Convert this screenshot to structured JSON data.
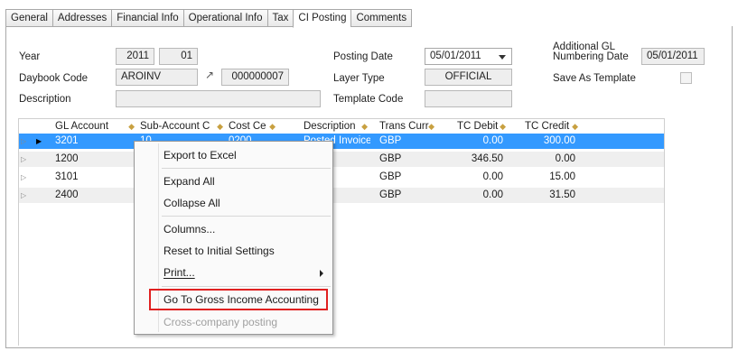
{
  "tabs": [
    {
      "label": "General"
    },
    {
      "label": "Addresses"
    },
    {
      "label": "Financial Info"
    },
    {
      "label": "Operational Info"
    },
    {
      "label": "Tax"
    },
    {
      "label": "CI Posting",
      "active": true
    },
    {
      "label": "Comments"
    }
  ],
  "form": {
    "year_label": "Year",
    "year_value": "2011",
    "period_value": "01",
    "daybook_label": "Daybook Code",
    "daybook_value": "AROINV",
    "daybook_number": "000000007",
    "description_label": "Description",
    "description_value": "",
    "posting_date_label": "Posting Date",
    "posting_date_value": "05/01/2011",
    "layer_type_label": "Layer Type",
    "layer_type_value": "OFFICIAL",
    "template_code_label": "Template Code",
    "template_code_value": "",
    "additional_gl_label_1": "Additional GL",
    "additional_gl_label_2": "Numbering Date",
    "additional_gl_value": "05/01/2011",
    "save_as_template_label": "Save As Template"
  },
  "grid": {
    "columns": [
      "GL Account",
      "Sub-Account C",
      "Cost Ce",
      "Description",
      "Trans Curr",
      "TC Debit",
      "TC Credit"
    ],
    "rows": [
      {
        "gl": "3201",
        "sub": "10",
        "cost": "0200",
        "desc": "Posted Invoice",
        "curr": "GBP",
        "debit": "0.00",
        "credit": "300.00"
      },
      {
        "gl": "1200",
        "sub": "",
        "cost": "",
        "desc": "ce",
        "curr": "GBP",
        "debit": "346.50",
        "credit": "0.00"
      },
      {
        "gl": "3101",
        "sub": "",
        "cost": "",
        "desc": "ce",
        "curr": "GBP",
        "debit": "0.00",
        "credit": "15.00"
      },
      {
        "gl": "2400",
        "sub": "",
        "cost": "",
        "desc": "ce",
        "curr": "GBP",
        "debit": "0.00",
        "credit": "31.50"
      }
    ]
  },
  "context_menu": {
    "items": [
      {
        "label": "Export to Excel"
      },
      {
        "label": "Expand All"
      },
      {
        "label": "Collapse All"
      },
      {
        "label": "Columns..."
      },
      {
        "label": "Reset to Initial Settings"
      },
      {
        "label": "Print..."
      },
      {
        "label": "Go To Gross Income Accounting"
      },
      {
        "label": "Cross-company posting",
        "disabled": true
      }
    ]
  },
  "colors": {
    "selection": "#3399ff",
    "highlight_border": "#e02020"
  }
}
